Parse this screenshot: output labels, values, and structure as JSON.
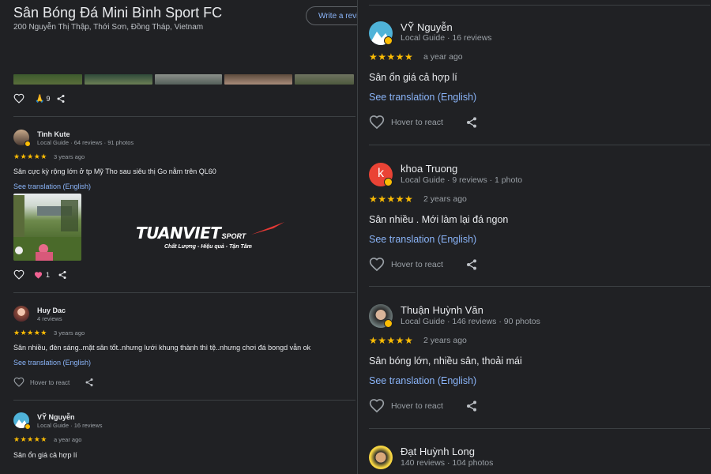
{
  "place": {
    "title": "Sân Bóng Đá Mini Bình Sport FC",
    "address": "200 Nguyễn Thị Thập, Thới Sơn, Đồng Tháp, Vietnam",
    "write_review": "Write a revi"
  },
  "top_actions": {
    "reaction_count": "9"
  },
  "left_reviews": [
    {
      "name": "Tình Kute",
      "meta": "Local Guide · 64 reviews · 91 photos",
      "stars": "★★★★★",
      "date": "3 years ago",
      "text": "Sân cực kỳ rộng lớn ở tp Mỹ Tho sau siêu thị Go nằm trên QL60",
      "translation": "See translation (English)",
      "reaction_count": "1",
      "banner": {
        "brand": "TUANVIET",
        "brand_suffix": "SPORT",
        "tagline": "Chất Lượng - Hiệu quả - Tận Tâm"
      }
    },
    {
      "name": "Huy Dac",
      "meta": "4 reviews",
      "stars": "★★★★★",
      "date": "3 years ago",
      "text": "Sân nhiều, đèn sáng..mặt sân tốt..nhưng lưới khung thành thì tệ..nhưng chơi đá bongd vẫn ok",
      "translation": "See translation (English)",
      "hover": "Hover to react"
    },
    {
      "name": "VỸ Nguyễn",
      "meta": "Local Guide · 16 reviews",
      "stars": "★★★★★",
      "date": "a year ago",
      "text": "Sân ổn giá cả hợp lí"
    }
  ],
  "right_reviews": [
    {
      "name": "VỸ Nguyễn",
      "meta": "Local Guide · 16 reviews",
      "stars": "★★★★★",
      "date": "a year ago",
      "text": "Sân ổn giá cả hợp lí",
      "translation": "See translation (English)",
      "hover": "Hover to react"
    },
    {
      "name": "khoa Truong",
      "initial": "k",
      "meta": "Local Guide · 9 reviews · 1 photo",
      "stars": "★★★★★",
      "date": "2 years ago",
      "text": "Sân nhiều . Mới làm lại đá ngon",
      "translation": "See translation (English)",
      "hover": "Hover to react"
    },
    {
      "name": "Thuận Huỳnh Văn",
      "meta": "Local Guide · 146 reviews · 90 photos",
      "stars": "★★★★★",
      "date": "2 years ago",
      "text": "Sân bóng lớn, nhiều sân, thoải mái",
      "translation": "See translation (English)",
      "hover": "Hover to react"
    },
    {
      "name": "Đạt Huỳnh Long",
      "meta": "140 reviews · 104 photos"
    }
  ],
  "colors": {
    "background": "#202124",
    "link": "#8ab4f8",
    "star": "#fbbc04",
    "muted": "#9aa0a6",
    "badge_red": "#ea4335"
  }
}
